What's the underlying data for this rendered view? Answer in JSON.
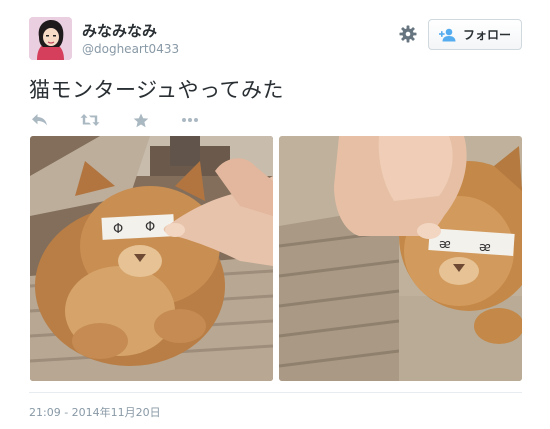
{
  "user": {
    "display_name": "みなみなみ",
    "handle": "@dogheart0433"
  },
  "follow_button": {
    "label": "フォロー"
  },
  "tweet": {
    "text": "猫モンタージュやってみた"
  },
  "actions": {
    "reply_icon": "reply-icon",
    "retweet_icon": "retweet-icon",
    "favorite_icon": "star-icon",
    "more_icon": "more-dots-icon"
  },
  "timestamp": "21:09 - 2014年11月20日",
  "colors": {
    "text": "#292f33",
    "muted": "#8899a6",
    "follow_icon": "#55acee",
    "icon_gray": "#aab8c2"
  }
}
